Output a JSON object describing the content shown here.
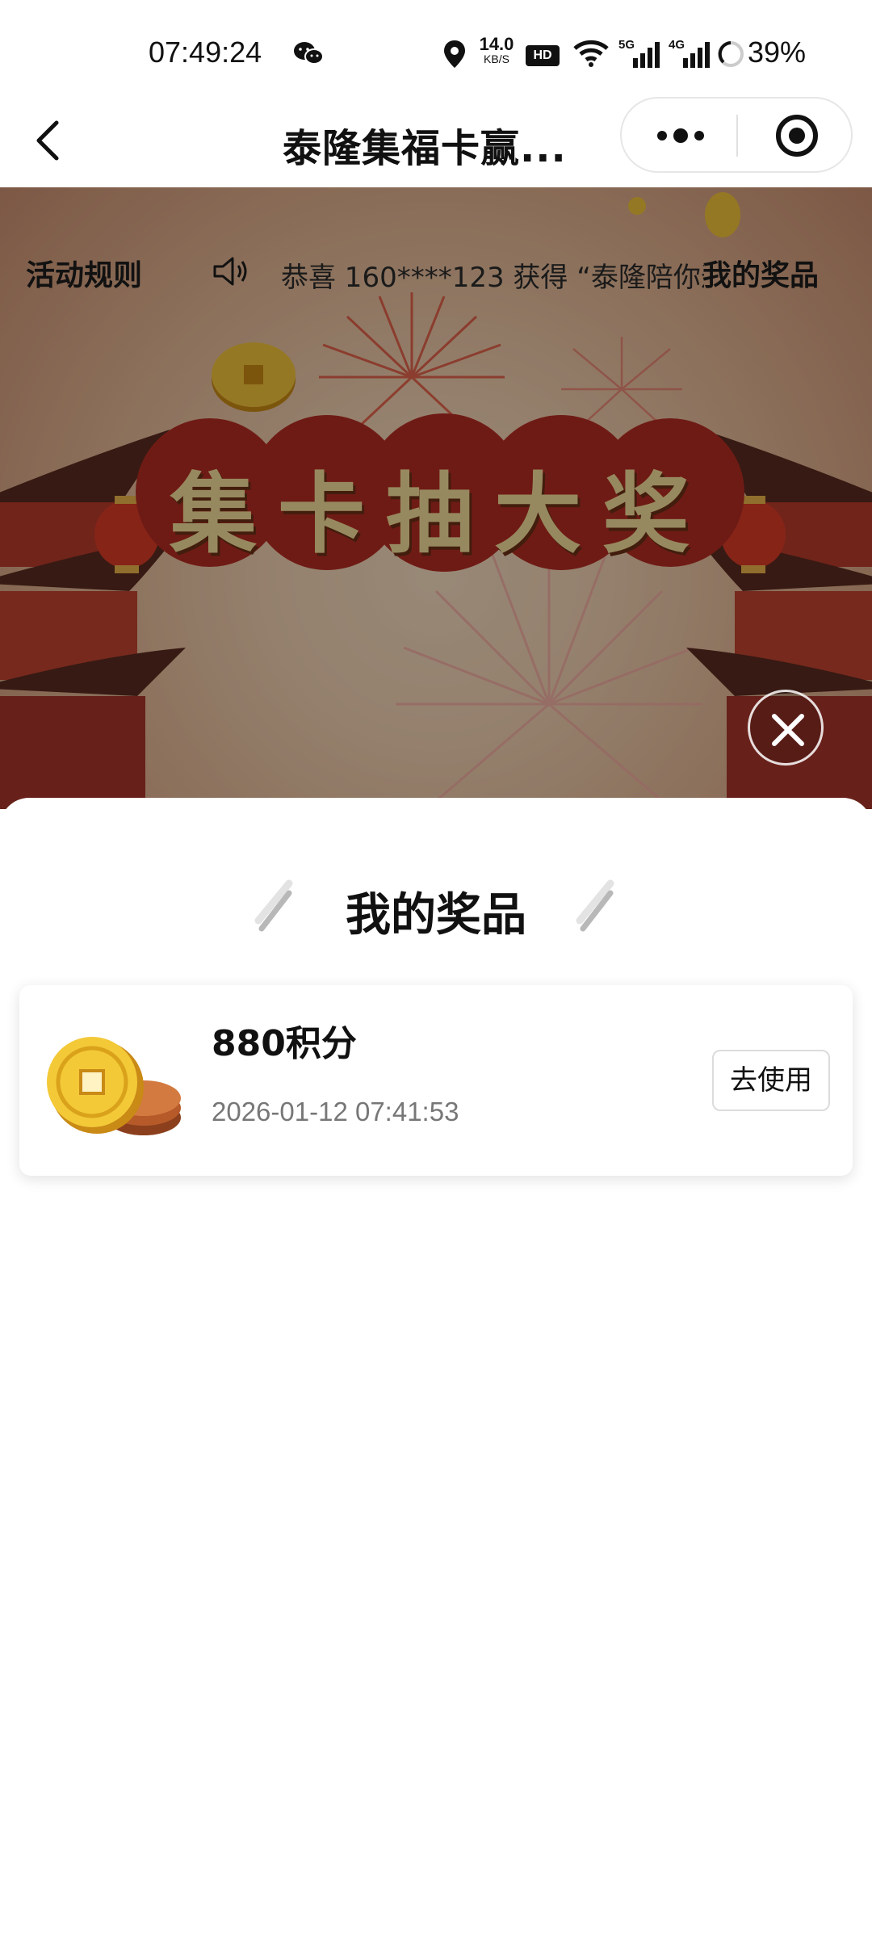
{
  "status_bar": {
    "time": "07:49:24",
    "net_speed_value": "14.0",
    "net_speed_unit": "KB/S",
    "hd_badge": "HD",
    "signal_5g": "5G",
    "signal_4g": "4G",
    "battery": "39%"
  },
  "nav": {
    "title": "泰隆集福卡赢..."
  },
  "banner": {
    "rules_label": "活动规则",
    "marquee_text": "恭喜 160****123 获得 “泰隆陪你过",
    "prizes_label": "我的奖品",
    "plaque_text": "集卡抽大奖"
  },
  "sheet": {
    "title": "我的奖品",
    "prizes": [
      {
        "name": "880积分",
        "time": "2026-01-12 07:41:53",
        "action_label": "去使用"
      }
    ]
  },
  "colors": {
    "plaque_red": "#b32c22",
    "gold_text": "#f4dd9a",
    "overlay": "rgba(0,0,0,0.38)"
  }
}
